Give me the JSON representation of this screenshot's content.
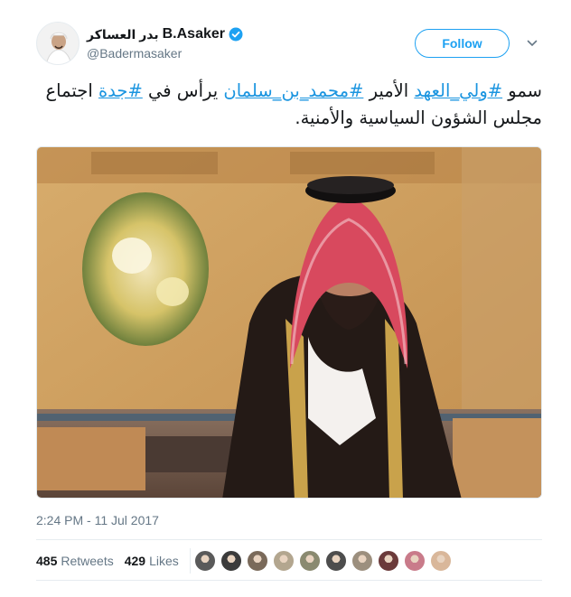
{
  "tweet": {
    "author": {
      "arabic_name": "بدر العساكر",
      "display_name": "B.Asaker",
      "handle": "@Badermasaker",
      "verified_icon": "verified-badge-icon",
      "avatar_icon": "avatar"
    },
    "follow_label": "Follow",
    "menu_icon": "chevron-down-icon",
    "text_parts": [
      {
        "text": "سمو ",
        "tag": false
      },
      {
        "text": "#ولي_العهد",
        "tag": true
      },
      {
        "text": " الأمير ",
        "tag": false
      },
      {
        "text": "#محمد_بن_سلمان",
        "tag": true
      },
      {
        "text": " يرأس في ",
        "tag": false
      },
      {
        "text": "#جدة",
        "tag": true
      },
      {
        "text": " اجتماع مجلس الشؤون السياسية والأمنية.",
        "tag": false
      }
    ],
    "timestamp": "2:24 PM - 11 Jul 2017",
    "retweets_count": "485",
    "retweets_label": "Retweets",
    "likes_count": "429",
    "likes_label": "Likes",
    "liker_avatar_count": 10,
    "colors": {
      "accent": "#1da1f2",
      "hashtag": "#1b95e0",
      "muted": "#657786",
      "text": "#14171a",
      "divider": "#e6ecf0"
    }
  }
}
